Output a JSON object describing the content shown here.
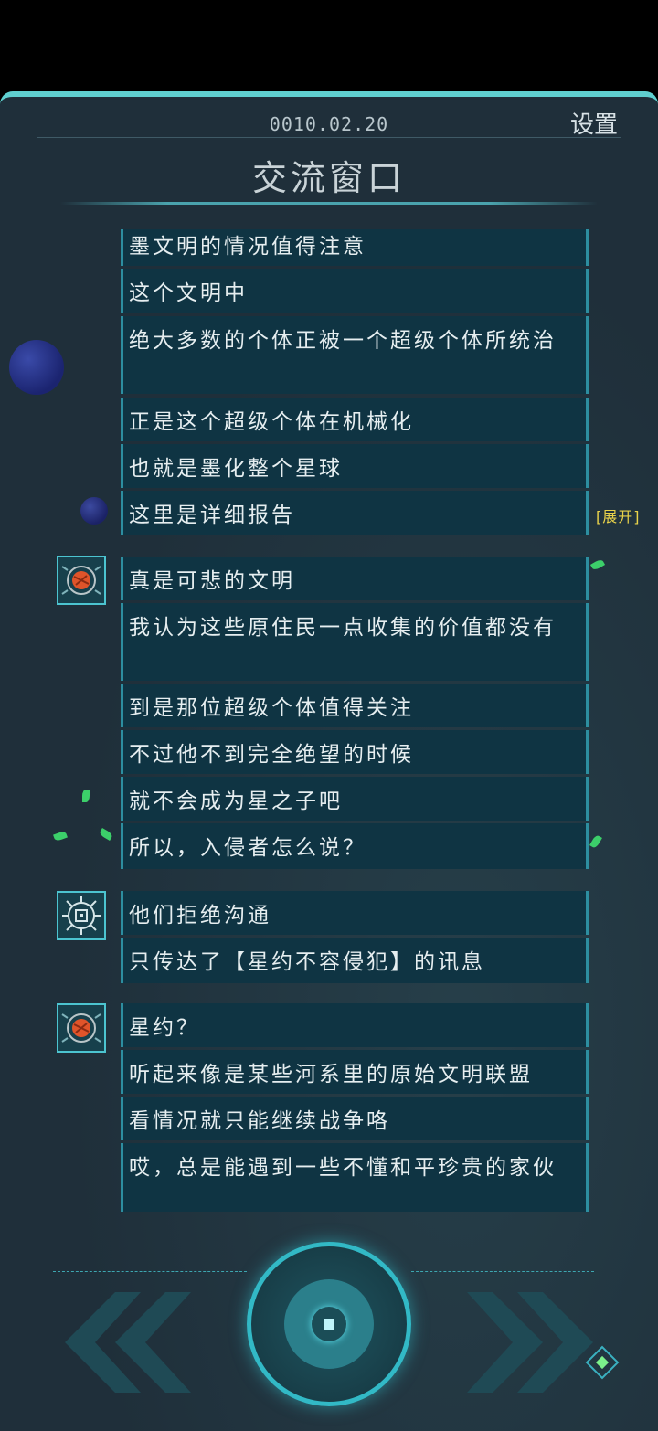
{
  "header": {
    "date": "0010.02.20",
    "settings_label": "设置",
    "title": "交流窗口"
  },
  "chat": {
    "expand_label": "[展开]",
    "messages": [
      "墨文明的情况值得注意",
      "这个文明中",
      "绝大多数的个体正被一个超级个体所统治",
      "正是这个超级个体在机械化",
      "也就是墨化整个星球",
      "这里是详细报告",
      "真是可悲的文明",
      "我认为这些原住民一点收集的价值都没有",
      "到是那位超级个体值得关注",
      "不过他不到完全绝望的时候",
      "就不会成为星之子吧",
      "所以，入侵者怎么说？",
      "他们拒绝沟通",
      "只传达了【星约不容侵犯】的讯息",
      "星约？",
      "听起来像是某些河系里的原始文明联盟",
      "看情况就只能继续战争咯",
      "哎，总是能遇到一些不懂和平珍贵的家伙"
    ],
    "avatars": [
      "planet-avatar-icon",
      "circuit-chip-avatar-icon",
      "planet-avatar-icon"
    ]
  },
  "controls": {
    "prev_icon": "double-chevron-left-icon",
    "next_icon": "double-chevron-right-icon",
    "center_icon": "record-button-icon"
  },
  "colors": {
    "accent": "#32b9c6",
    "bubble": "#0f3443",
    "panel": "#1f2f3a",
    "expand": "#e8d24a"
  }
}
